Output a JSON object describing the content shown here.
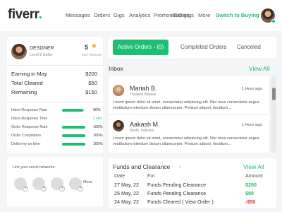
{
  "brand": {
    "name": "fiverr",
    "dot": ".",
    "accent": "#1dbf73"
  },
  "nav": {
    "items": [
      "Messages",
      "Orders",
      "Gigs",
      "Analytics",
      "Promoted Gigs",
      "Earnings",
      "More"
    ],
    "switch_label": "Switch to Buying",
    "avatar_icon": "user-avatar"
  },
  "profile": {
    "name": "DESGNER",
    "level": "Level 2 Seller",
    "rating": "5",
    "reviews": "300+ Reviews"
  },
  "earnings": [
    {
      "label": "Earning in May",
      "value": "$200"
    },
    {
      "label": "Total Cleared",
      "value": "$50"
    },
    {
      "label": "Remaining",
      "value": "$150"
    }
  ],
  "stats": [
    {
      "label": "Inbox Response Rate",
      "value": "90%",
      "fill": 0.9,
      "bar": true
    },
    {
      "label": "Inbox Response Time",
      "value": "1 Hrs",
      "bar": false
    },
    {
      "label": "Order Response Rate",
      "value": "100%",
      "fill": 1.0,
      "bar": true
    },
    {
      "label": "Order Completion",
      "value": "100%",
      "fill": 1.0,
      "bar": true
    },
    {
      "label": "Delievery on time",
      "value": "100%",
      "fill": 1.0,
      "bar": true
    }
  ],
  "social": {
    "title": "Link your social networks:",
    "more": "More"
  },
  "tabs": {
    "active": "Active Orders - (0)",
    "completed": "Completed Orders",
    "canceled": "Canceled"
  },
  "inbox": {
    "title": "Inbox",
    "view_all": "View All",
    "messages": [
      {
        "name": "Mariah B.",
        "location": "Thailand Bankok",
        "time": "1 Hour ago",
        "body": "Lorem ipsum dolor sit amet, consectetur adipiscing elit. Nisi risus consectetur augue vestibulum interdum dictum ullamcorper. Pretium aliquet, tincidunt..."
      },
      {
        "name": "Aakash M.",
        "location": "Sindh, Pakistan",
        "time": "1 Hour ago",
        "body": "Lorem ipsum dolor sit amet, consectetur adipiscing elit. Nisi risus consectetur augue vestibulum interdum dictum ullamcorper. Pretium aliquet, tincidunt..."
      }
    ]
  },
  "funds": {
    "title": "Funds and Clearance",
    "view_all": "View All",
    "headers": {
      "date": "Date",
      "for": "For",
      "amount": "Amount"
    },
    "rows": [
      {
        "date": "27 May, 22",
        "for": "Funds Pending Clearance",
        "amount": "$200",
        "color": "#1dbf73"
      },
      {
        "date": "25 May, 22",
        "for": "Funds Pending Clearance",
        "amount": "$80",
        "color": "#1dbf73"
      },
      {
        "date": "24 May, 22",
        "for": "Funds Cleared ( View Order )",
        "amount": "-$50",
        "color": "#e53935"
      }
    ]
  }
}
